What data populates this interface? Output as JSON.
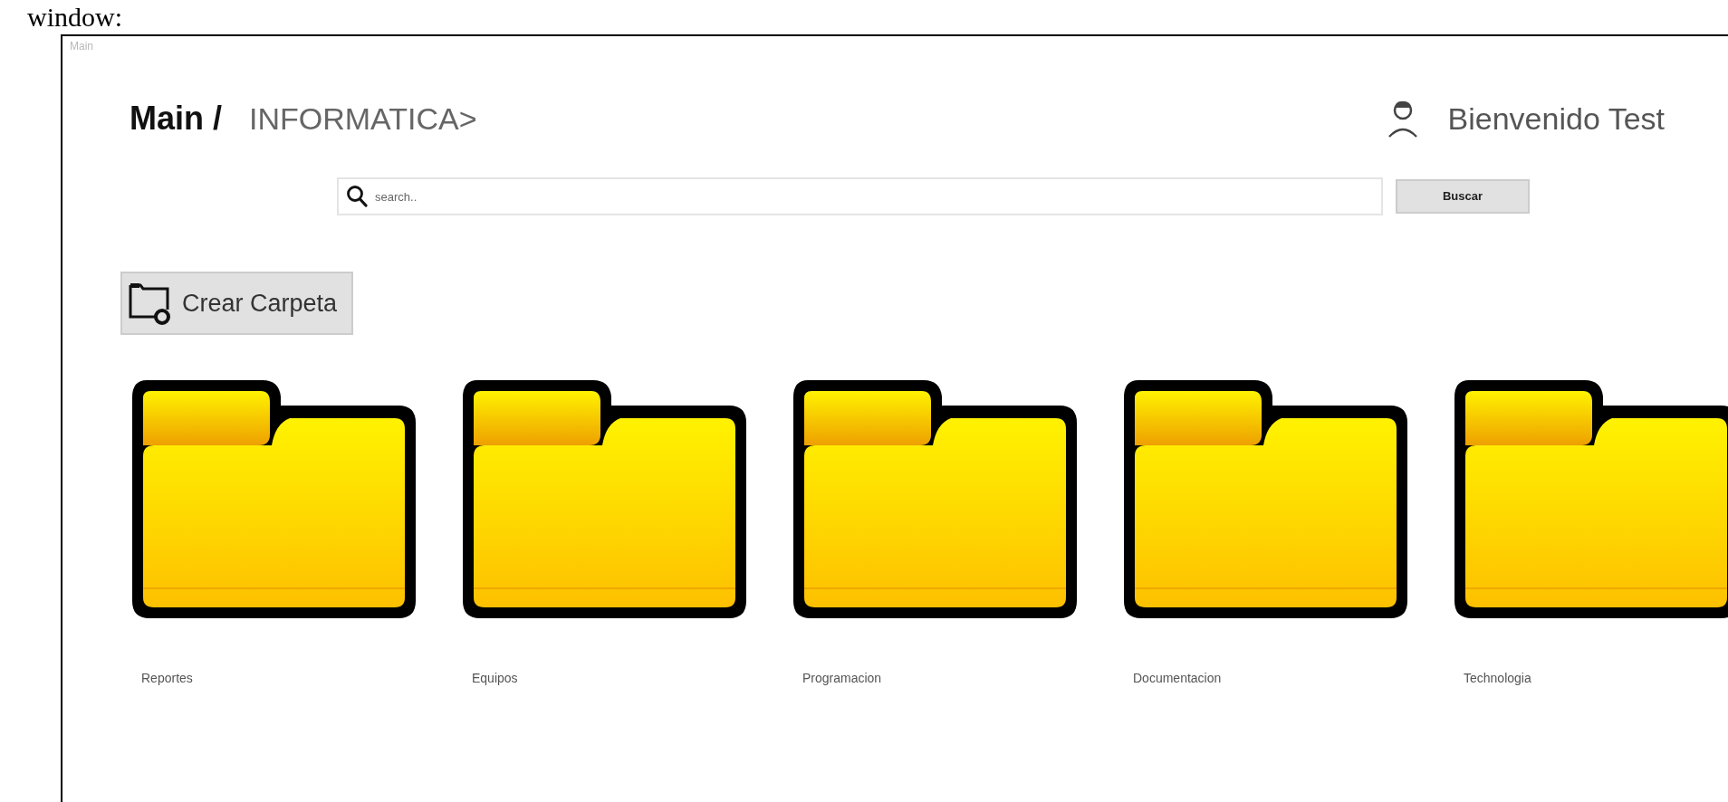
{
  "caption": "window:",
  "window": {
    "title": "Main"
  },
  "breadcrumb": {
    "root": "Main /",
    "current": "INFORMATICA>"
  },
  "user": {
    "greeting": "Bienvenido Test"
  },
  "search": {
    "placeholder": "search..",
    "button": "Buscar"
  },
  "create_button": "Crear Carpeta",
  "folders": [
    {
      "name": "Reportes"
    },
    {
      "name": "Equipos"
    },
    {
      "name": "Programacion"
    },
    {
      "name": "Documentacion"
    },
    {
      "name": "Technologia"
    }
  ]
}
